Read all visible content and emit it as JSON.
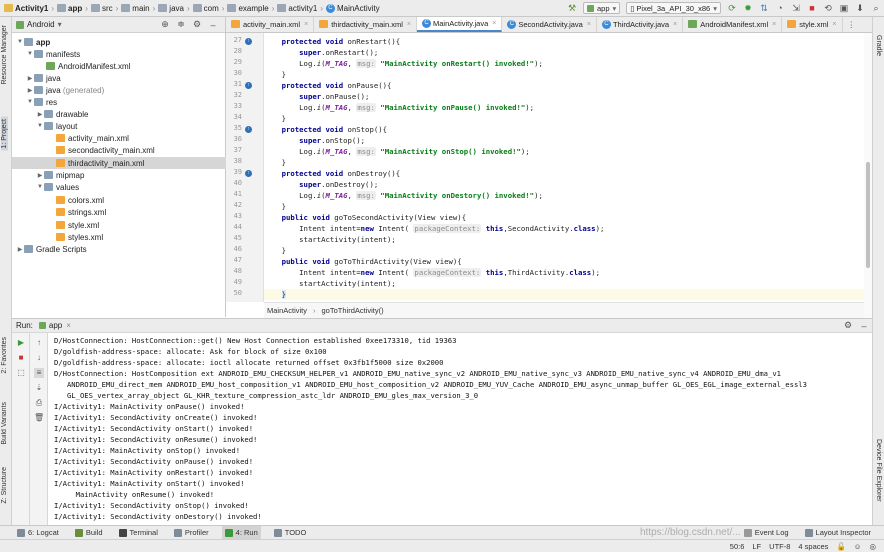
{
  "nav": {
    "crumbs": [
      "Activity1",
      "app",
      "src",
      "main",
      "java",
      "com",
      "example",
      "activity1",
      "MainActivity"
    ],
    "run_config": "app",
    "device": "Pixel_3a_API_30_x86"
  },
  "project": {
    "view": "Android",
    "tree": [
      {
        "label": "app",
        "bold": true
      },
      {
        "label": "manifests"
      },
      {
        "label": "AndroidManifest.xml"
      },
      {
        "label": "java"
      },
      {
        "label": "java",
        "suffix": "(generated)"
      },
      {
        "label": "res"
      },
      {
        "label": "drawable"
      },
      {
        "label": "layout"
      },
      {
        "label": "activity_main.xml"
      },
      {
        "label": "secondactivity_main.xml"
      },
      {
        "label": "thirdactivity_main.xml"
      },
      {
        "label": "mipmap"
      },
      {
        "label": "values"
      },
      {
        "label": "colors.xml"
      },
      {
        "label": "strings.xml"
      },
      {
        "label": "style.xml"
      },
      {
        "label": "styles.xml"
      },
      {
        "label": "Gradle Scripts"
      }
    ]
  },
  "tabs": [
    "activity_main.xml",
    "thirdactivity_main.xml",
    "MainActivity.java",
    "SecondActivity.java",
    "ThirdActivity.java",
    "AndroidManifest.xml",
    "style.xml"
  ],
  "side": {
    "left": [
      "Resource Manager",
      "1: Project",
      "2: Favorites",
      "Build Variants",
      "Z: Structure"
    ],
    "right": [
      "Gradle",
      "Device File Explorer"
    ]
  },
  "editor": {
    "lines": [
      "27",
      "28",
      "29",
      "30",
      "31",
      "32",
      "33",
      "34",
      "35",
      "36",
      "37",
      "38",
      "39",
      "40",
      "41",
      "42",
      "43",
      "44",
      "45",
      "46",
      "47",
      "48",
      "49",
      "50"
    ],
    "code": {
      "l27a": "protected void",
      "l27b": " onRestart(){",
      "l28": "super",
      "l28b": ".onRestart();",
      "log_prefix": "Log.",
      "log_fn": "i",
      "tag": "M_TAG",
      "msg_hint": "msg:",
      "s29": "\"MainActivity onRestart() invoked!\"",
      "close": "}",
      "l31b": " onPause(){",
      "l32b": ".onPause();",
      "s33": "\"MainActivity onPause() invoked!\"",
      "l35b": " onStop(){",
      "l36b": ".onStop();",
      "s37": "\"MainActivity onStop() invoked!\"",
      "l39b": " onDestroy(){",
      "l40b": ".onDestroy();",
      "s41": "\"MainActivity onDestory() invoked!\"",
      "l43a": "public void",
      "l43b": " goToSecondActivity(View view){",
      "intent_a": "Intent intent=",
      "new_kw": "new",
      "intent_b": " Intent(",
      "ctx_hint": "packageContext:",
      "this_kw": "this",
      "l44c": ",SecondActivity.",
      "class_kw": "class",
      "end_paren": ");",
      "start": "startActivity(intent);",
      "l47b": " goToThirdActivity(View view){",
      "l48c": ",ThirdActivity.",
      "sep": ", ",
      "semi": ");"
    },
    "breadcrumb": [
      "MainActivity",
      "goToThirdActivity()"
    ]
  },
  "run": {
    "label": "Run:",
    "config": "app",
    "log": [
      "D/HostConnection: HostConnection::get() New Host Connection established 0xee173310, tid 19363",
      "D/goldfish-address-space: allocate: Ask for block of size 0x100",
      "D/goldfish-address-space: allocate: ioctl allocate returned offset 0x3fb1f5000 size 0x2000",
      "D/HostConnection: HostComposition ext ANDROID_EMU_CHECKSUM_HELPER_v1 ANDROID_EMU_native_sync_v2 ANDROID_EMU_native_sync_v3 ANDROID_EMU_native_sync_v4 ANDROID_EMU_dma_v1",
      "   ANDROID_EMU_direct_mem ANDROID_EMU_host_composition_v1 ANDROID_EMU_host_composition_v2 ANDROID_EMU_YUV_Cache ANDROID_EMU_async_unmap_buffer GL_OES_EGL_image_external_essl3",
      "   GL_OES_vertex_array_object GL_KHR_texture_compression_astc_ldr ANDROID_EMU_gles_max_version_3_0",
      "I/Activity1: MainActivity onPause() invoked!",
      "I/Activity1: SecondActivity onCreate() invoked!",
      "I/Activity1: SecondActivity onStart() invoked!",
      "I/Activity1: SecondActivity onResume() invoked!",
      "I/Activity1: MainActivity onStop() invoked!",
      "I/Activity1: SecondActivity onPause() invoked!",
      "I/Activity1: MainActivity onRestart() invoked!",
      "I/Activity1: MainActivity onStart() invoked!",
      "     MainActivity onResume() invoked!",
      "I/Activity1: SecondActivity onStop() invoked!",
      "I/Activity1: SecondActivity onDestory() invoked!"
    ]
  },
  "toolbar": [
    "6: Logcat",
    "Build",
    "Terminal",
    "Profiler",
    "4: Run",
    "TODO"
  ],
  "toolbar_right": [
    "Event Log",
    "Layout Inspector"
  ],
  "status": [
    "50:6",
    "LF",
    "UTF-8",
    "4 spaces"
  ],
  "watermark": "https://blog.csdn.net/..."
}
